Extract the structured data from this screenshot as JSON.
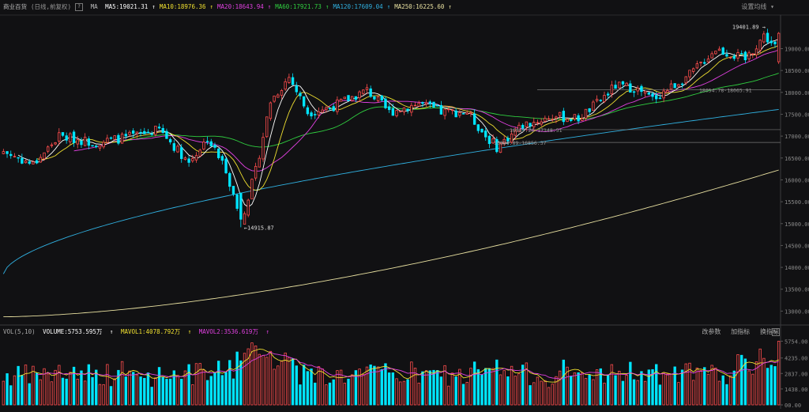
{
  "header": {
    "title": "商业百货",
    "mode": "(日线,前复权)",
    "help": "?",
    "ma_label": "MA",
    "ma": [
      {
        "label": "MA5:19021.31",
        "color": "#ffffff"
      },
      {
        "label": "MA10:18976.36",
        "color": "#f0e030"
      },
      {
        "label": "MA20:18643.94",
        "color": "#e040e0"
      },
      {
        "label": "MA60:17921.73",
        "color": "#30d040"
      },
      {
        "label": "MA120:17609.04",
        "color": "#30b0e0"
      },
      {
        "label": "MA250:16225.60",
        "color": "#e8e0a0"
      }
    ],
    "arrow": "↑",
    "settings": "设置均线 ▾"
  },
  "volume_header": {
    "label": "VOL(5,10)",
    "volume": "VOLUME:5753.595万",
    "mavol1": "MAVOL1:4078.792万",
    "mavol2": "MAVOL2:3536.619万",
    "arrow": "↑",
    "buttons": [
      "改参数",
      "加指标",
      "换指标"
    ],
    "close": "×"
  },
  "chart_data": {
    "type": "candlestick",
    "colors": {
      "up": "#ff4d4d",
      "down": "#00e5ff",
      "ma5": "#ffffff",
      "ma10": "#f0e030",
      "ma20": "#e040e0",
      "ma60": "#30d040",
      "ma120": "#30b0e0",
      "ma250": "#e8e0a0"
    },
    "price_axis": {
      "range": [
        12700,
        19750
      ],
      "ticks": [
        "19000.00",
        "18500.00",
        "18000.00",
        "17500.00",
        "17000.00",
        "16500.00",
        "16000.00",
        "15500.00",
        "15000.00",
        "14500.00",
        "14000.00",
        "13500.00",
        "13000.00"
      ]
    },
    "volume_axis": {
      "range": [
        0,
        6000
      ],
      "ticks": [
        "5754.00",
        "4235.00",
        "2837.00",
        "1438.00",
        "00.00"
      ]
    },
    "annotations": {
      "high": "19401.89",
      "low": "14915.87",
      "ref_lines": [
        "18054.78-18065.91",
        "16987.26-17148.51",
        "16854.89-16856.37"
      ]
    },
    "key_points": [
      [
        0,
        16650
      ],
      [
        8,
        16350
      ],
      [
        15,
        17000
      ],
      [
        25,
        16850
      ],
      [
        35,
        17000
      ],
      [
        42,
        17150
      ],
      [
        50,
        16400
      ],
      [
        55,
        16950
      ],
      [
        60,
        16250
      ],
      [
        64,
        15050
      ],
      [
        68,
        16200
      ],
      [
        72,
        17800
      ],
      [
        77,
        18350
      ],
      [
        82,
        17550
      ],
      [
        88,
        17650
      ],
      [
        98,
        18050
      ],
      [
        104,
        17550
      ],
      [
        112,
        17750
      ],
      [
        118,
        17550
      ],
      [
        125,
        17550
      ],
      [
        130,
        17000
      ],
      [
        133,
        16750
      ],
      [
        140,
        17250
      ],
      [
        148,
        17450
      ],
      [
        155,
        17400
      ],
      [
        160,
        17750
      ],
      [
        165,
        18150
      ],
      [
        170,
        18100
      ],
      [
        175,
        17850
      ],
      [
        185,
        18400
      ],
      [
        192,
        19000
      ],
      [
        200,
        18750
      ],
      [
        205,
        19300
      ],
      [
        210,
        18900
      ]
    ],
    "candle_count": 210,
    "series_start": {
      "ma60": [
        16900,
        17150
      ],
      "ma120": [
        13850,
        15900
      ],
      "ma250": [
        12870,
        12870
      ]
    },
    "series_end": {
      "ma60": 17921.73,
      "ma120": 17609.04,
      "ma250": 16225.6
    },
    "last_volume": 5753.595,
    "mavol1": 4078.792,
    "mavol2": 3536.619
  }
}
